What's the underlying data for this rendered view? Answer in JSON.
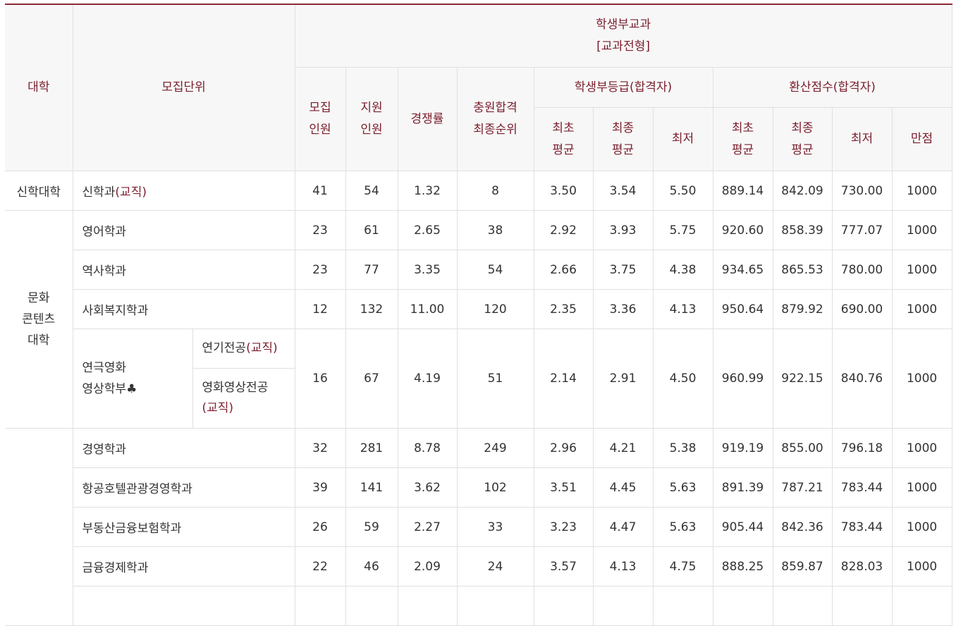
{
  "header": {
    "college": "대학",
    "unit": "모집단위",
    "group_line1": "학생부교과",
    "group_line2": "[교과전형]",
    "recruit_line1": "모집",
    "recruit_line2": "인원",
    "apply_line1": "지원",
    "apply_line2": "인원",
    "competition": "경쟁률",
    "rank_line1": "충원합격",
    "rank_line2": "최종순위",
    "grade_group": "학생부등급(합격자)",
    "score_group": "환산점수(합격자)",
    "first_avg_line1": "최초",
    "first_avg_line2": "평균",
    "final_avg_line1": "최종",
    "final_avg_line2": "평균",
    "lowest": "최저",
    "full": "만점"
  },
  "marks": {
    "teaching": "(교직)",
    "club": "♣"
  },
  "colleges": {
    "theology": "신학대학",
    "culture_line1": "문화",
    "culture_line2": "콘텐츠",
    "culture_line3": "대학"
  },
  "rows": [
    {
      "unit": "신학과",
      "recruit": "41",
      "apply": "54",
      "comp": "1.32",
      "rank": "8",
      "g_first": "3.50",
      "g_final": "3.54",
      "g_low": "5.50",
      "s_first": "889.14",
      "s_final": "842.09",
      "s_low": "730.00",
      "s_full": "1000"
    },
    {
      "unit": "영어학과",
      "recruit": "23",
      "apply": "61",
      "comp": "2.65",
      "rank": "38",
      "g_first": "2.92",
      "g_final": "3.93",
      "g_low": "5.75",
      "s_first": "920.60",
      "s_final": "858.39",
      "s_low": "777.07",
      "s_full": "1000"
    },
    {
      "unit": "역사학과",
      "recruit": "23",
      "apply": "77",
      "comp": "3.35",
      "rank": "54",
      "g_first": "2.66",
      "g_final": "3.75",
      "g_low": "4.38",
      "s_first": "934.65",
      "s_final": "865.53",
      "s_low": "780.00",
      "s_full": "1000"
    },
    {
      "unit": "사회복지학과",
      "recruit": "12",
      "apply": "132",
      "comp": "11.00",
      "rank": "120",
      "g_first": "2.35",
      "g_final": "3.36",
      "g_low": "4.13",
      "s_first": "950.64",
      "s_final": "879.92",
      "s_low": "690.00",
      "s_full": "1000"
    },
    {
      "unit_line1": "연극영화",
      "unit_line2": "영상학부",
      "sub1": "연기전공",
      "sub2_line1": "영화영상전공",
      "recruit": "16",
      "apply": "67",
      "comp": "4.19",
      "rank": "51",
      "g_first": "2.14",
      "g_final": "2.91",
      "g_low": "4.50",
      "s_first": "960.99",
      "s_final": "922.15",
      "s_low": "840.76",
      "s_full": "1000"
    },
    {
      "unit": "경영학과",
      "recruit": "32",
      "apply": "281",
      "comp": "8.78",
      "rank": "249",
      "g_first": "2.96",
      "g_final": "4.21",
      "g_low": "5.38",
      "s_first": "919.19",
      "s_final": "855.00",
      "s_low": "796.18",
      "s_full": "1000"
    },
    {
      "unit": "항공호텔관광경영학과",
      "recruit": "39",
      "apply": "141",
      "comp": "3.62",
      "rank": "102",
      "g_first": "3.51",
      "g_final": "4.45",
      "g_low": "5.63",
      "s_first": "891.39",
      "s_final": "787.21",
      "s_low": "783.44",
      "s_full": "1000"
    },
    {
      "unit": "부동산금융보험학과",
      "recruit": "26",
      "apply": "59",
      "comp": "2.27",
      "rank": "33",
      "g_first": "3.23",
      "g_final": "4.47",
      "g_low": "5.63",
      "s_first": "905.44",
      "s_final": "842.36",
      "s_low": "783.44",
      "s_full": "1000"
    },
    {
      "unit": "금융경제학과",
      "recruit": "22",
      "apply": "46",
      "comp": "2.09",
      "rank": "24",
      "g_first": "3.57",
      "g_final": "4.13",
      "g_low": "4.75",
      "s_first": "888.25",
      "s_final": "859.87",
      "s_low": "828.03",
      "s_full": "1000"
    }
  ]
}
